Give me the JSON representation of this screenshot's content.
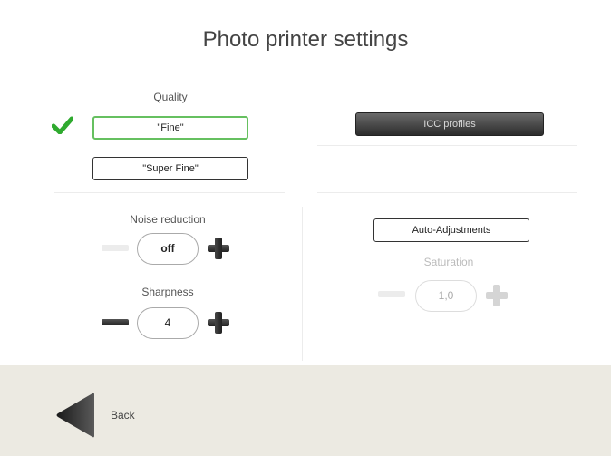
{
  "title": "Photo printer settings",
  "quality": {
    "label": "Quality",
    "options": [
      {
        "label": "\"Fine\"",
        "selected": true
      },
      {
        "label": "\"Super Fine\"",
        "selected": false
      }
    ]
  },
  "icc": {
    "label": "ICC profiles"
  },
  "noise_reduction": {
    "label": "Noise reduction",
    "value": "off",
    "minus_enabled": false,
    "plus_enabled": true
  },
  "sharpness": {
    "label": "Sharpness",
    "value": "4",
    "minus_enabled": true,
    "plus_enabled": true
  },
  "auto_adjustments": {
    "label": "Auto-Adjustments"
  },
  "saturation": {
    "label": "Saturation",
    "value": "1,0",
    "enabled": false
  },
  "footer": {
    "back_label": "Back"
  },
  "colors": {
    "selected_border": "#66c060",
    "checkmark": "#2faa2f",
    "footer_bg": "#eceae2"
  }
}
